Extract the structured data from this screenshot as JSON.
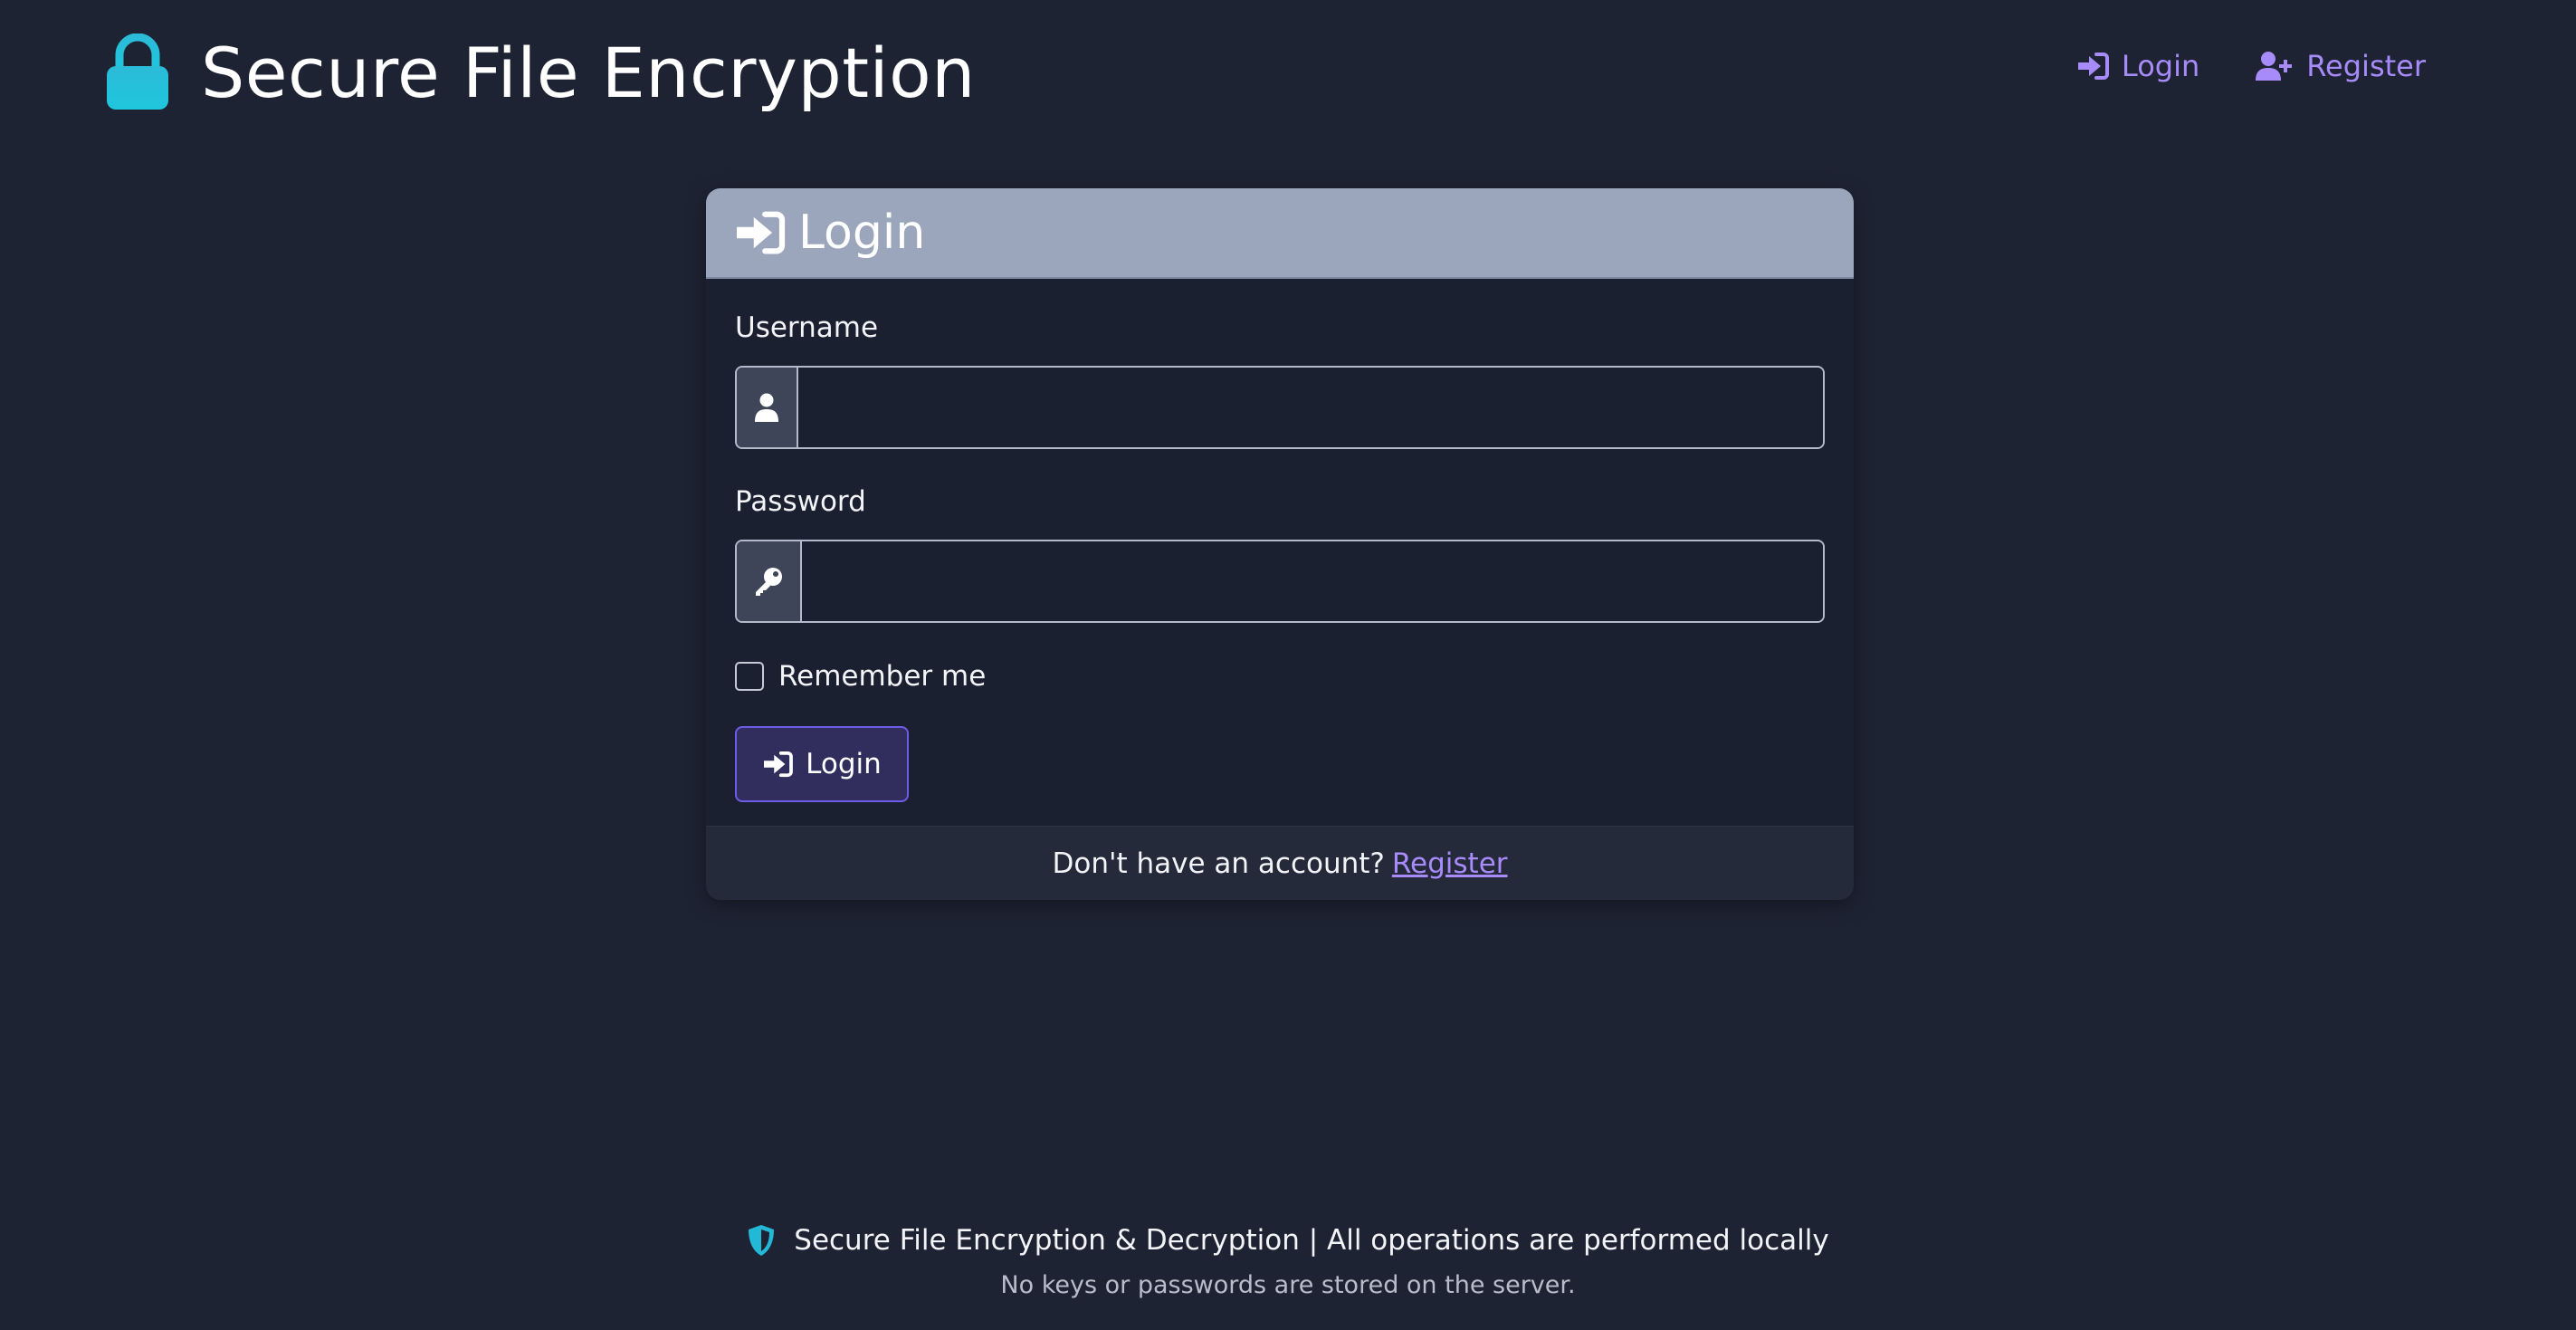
{
  "app": {
    "title": "Secure File Encryption"
  },
  "nav": {
    "login_label": "Login",
    "register_label": "Register"
  },
  "card": {
    "title": "Login",
    "username_label": "Username",
    "username_value": "",
    "password_label": "Password",
    "password_value": "",
    "remember_label": "Remember me",
    "remember_checked": false,
    "submit_label": "Login",
    "footer_text": "Don't have an account?",
    "footer_link": "Register"
  },
  "footer": {
    "line1": "Secure File Encryption & Decryption | All operations are performed locally",
    "line2": "No keys or passwords are stored on the server."
  },
  "colors": {
    "background": "#1e2333",
    "accent": "#a78bfa",
    "brand_icon": "#22b8d6",
    "card_header": "#9ba6bc",
    "button_border": "#6c5ce7"
  },
  "icons": {
    "brand": "lock-icon",
    "nav_login": "sign-in-icon",
    "nav_register": "user-plus-icon",
    "username": "user-icon",
    "password": "key-icon",
    "footer": "shield-icon"
  }
}
